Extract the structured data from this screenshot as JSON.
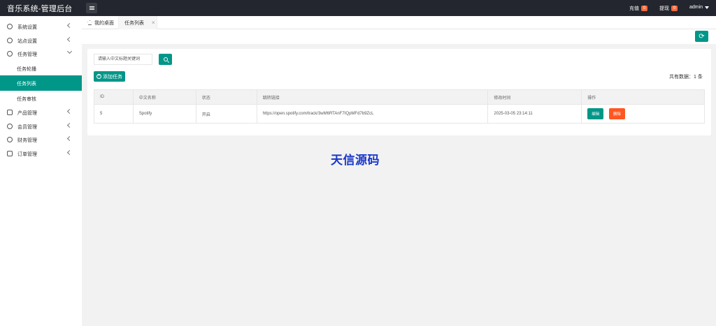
{
  "app": {
    "title": "音乐系统-管理后台"
  },
  "header": {
    "recharge_label": "充值",
    "recharge_count": "0",
    "withdraw_label": "提现",
    "withdraw_count": "0",
    "user_name": "admin"
  },
  "sidebar": {
    "items": [
      {
        "label": "系统设置"
      },
      {
        "label": "站点设置"
      },
      {
        "label": "任务管理"
      },
      {
        "label": "产品管理"
      },
      {
        "label": "会员管理"
      },
      {
        "label": "财务管理"
      },
      {
        "label": "订单管理"
      }
    ],
    "subitems": [
      {
        "label": "任务轮播"
      },
      {
        "label": "任务列表"
      },
      {
        "label": "任务审核"
      }
    ]
  },
  "tabs": [
    {
      "label": "我的桌面"
    },
    {
      "label": "任务列表"
    }
  ],
  "search": {
    "placeholder": "请输入中文标题关键词"
  },
  "toolbar": {
    "add_label": "添加任务",
    "total_text": "共有数据：1 条"
  },
  "table": {
    "headers": [
      "ID",
      "中文名称",
      "状态",
      "跳转链接",
      "修改时间",
      "操作"
    ],
    "rows": [
      {
        "id": "5",
        "name": "Spotify",
        "status": "开启",
        "link": "https://open.spotify.com/track/3wM6RTAnF7IQpMFd7b9ZcL",
        "time": "2025-03-05 23:14:11",
        "edit": "编辑",
        "delete": "删除"
      }
    ]
  },
  "watermark": "天信源码",
  "colors": {
    "primary": "#009688",
    "danger": "#ff5722",
    "header_bg": "#23262e",
    "badge": "#f16b3f"
  }
}
